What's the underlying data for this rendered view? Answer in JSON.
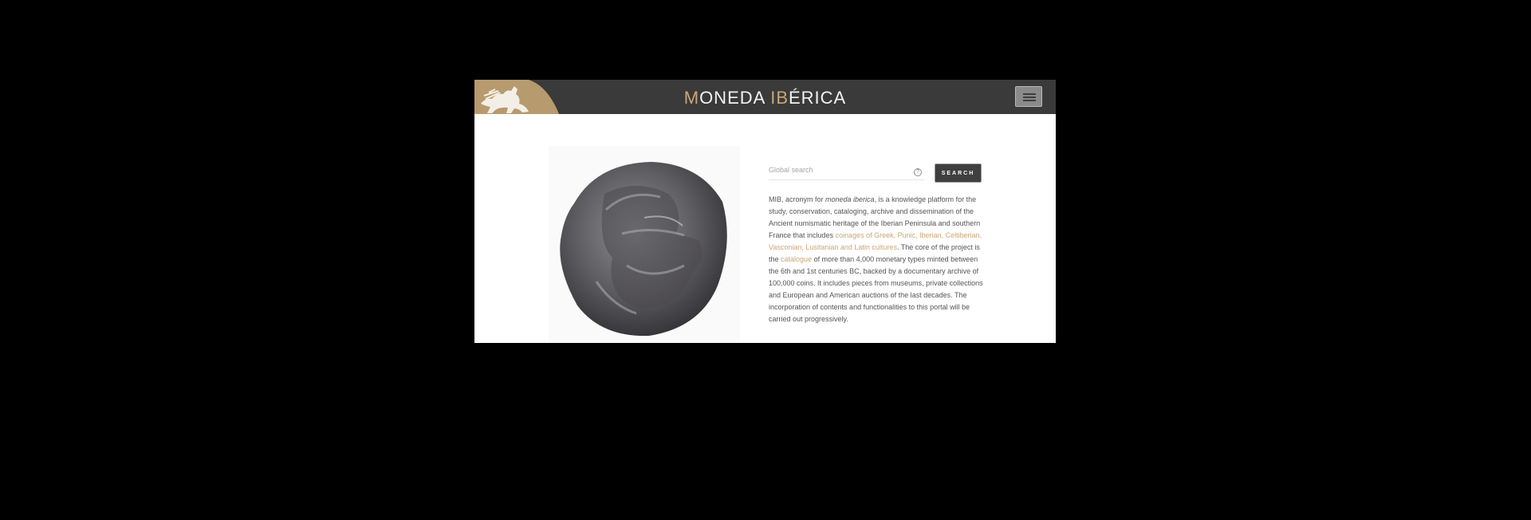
{
  "header": {
    "brand_accent_1": "M",
    "brand_text_1": "ONEDA ",
    "brand_accent_2": "IB",
    "brand_text_2": "ÉRICA",
    "menu_icon": "hamburger-menu-icon"
  },
  "colors": {
    "accent": "#c9a774",
    "header_bg": "#3a3a3a",
    "page_bg": "#ffffff",
    "backdrop": "#000000"
  },
  "search": {
    "placeholder": "Global search",
    "value": "",
    "help_glyph": "?",
    "button_label": "SEARCH"
  },
  "intro": {
    "p1": "MIB, acronym for ",
    "p1_em": "moneda iberica",
    "p2": ", is a knowledge platform for the study, conservation, cataloging, archive and dissemination of the Ancient numismatic heritage of the Iberian Peninsula and southern France that includes ",
    "link_coinages": "coinages of Greek, Punic, Iberian, Celtiberian, Vasconian, Lusitanian and Latin cultures",
    "p3": ". The core of the project is the ",
    "link_catalogue": "catalogue",
    "p4": " of more than 4,000 monetary types minted between the 6th and 1st centuries BC, backed by a documentary archive of 100,000 coins. It includes pieces from museums, private collections and European and American auctions of the last decades. The incorporation of contents and functionalities to this portal will be carried out progressively."
  },
  "images": {
    "hero_coin": "silver-coin-helmeted-head",
    "emblem": "horse-rider-emblem"
  }
}
